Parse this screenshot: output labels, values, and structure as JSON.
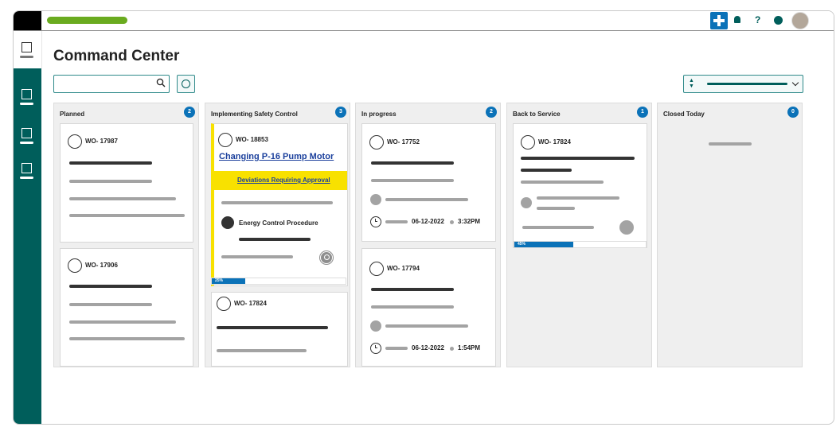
{
  "app": {
    "title": "Command Center"
  },
  "header": {
    "icons": [
      "plus-icon",
      "bell-icon",
      "help-icon",
      "status-dot-icon",
      "avatar"
    ],
    "help_label": "?"
  },
  "colors": {
    "accent": "#0b72b8",
    "rail": "#005e5b",
    "brand": "#6aab1f",
    "warning": "#f8e100"
  },
  "columns": [
    {
      "title": "Planned",
      "count": "2"
    },
    {
      "title": "Implementing Safety Control",
      "count": "3"
    },
    {
      "title": "In progress",
      "count": "2"
    },
    {
      "title": "Back to Service",
      "count": "1"
    },
    {
      "title": "Closed Today",
      "count": "0"
    }
  ],
  "planned": {
    "cards": [
      {
        "wo": "WO- 17987"
      },
      {
        "wo": "WO- 17906"
      }
    ]
  },
  "safety": {
    "card1": {
      "wo": "WO- 18853",
      "title": "Changing P-16 Pump Motor",
      "deviation": "Deviations Requiring Approval",
      "procedure": "Energy Control Procedure",
      "progress_label": "25%",
      "progress": 0.25
    },
    "card2": {
      "wo": "WO- 17824"
    }
  },
  "inprogress": {
    "card1": {
      "wo": "WO- 17752",
      "date": "06-12-2022",
      "time": "3:32PM"
    },
    "card2": {
      "wo": "WO- 17794",
      "date": "06-12-2022",
      "time": "1:54PM"
    }
  },
  "back": {
    "card1": {
      "wo": "WO- 17824",
      "progress_label": "45%",
      "progress": 0.45
    }
  }
}
